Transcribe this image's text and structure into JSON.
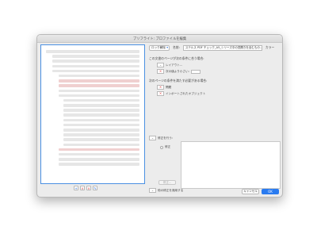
{
  "window": {
    "title": "プリフライト: プロファイルを編集"
  },
  "right": {
    "top": {
      "selected": "ロック解除",
      "label": "名前:",
      "name_value": "ステルス PDF チェック_A5_シリーズ中の見開きを含むもの…",
      "suffix": "カラー"
    },
    "group1": {
      "title": "この文書のページが次の条件に合う場合:",
      "row1": "レイアウト...",
      "row2": "次の値より小さい:"
    },
    "group2": {
      "title": "次のページの条件を満たす必要がある場合:",
      "row1": "問題",
      "row2": "インポートされたオブジェクト"
    },
    "fixups": {
      "title": "修正を行う:",
      "label": "修正",
      "buttons": [
        "修正..."
      ]
    },
    "bottom_check": "他の修正を適用する"
  },
  "footer": {
    "cancel": "キャンセル",
    "ok": "OK"
  }
}
